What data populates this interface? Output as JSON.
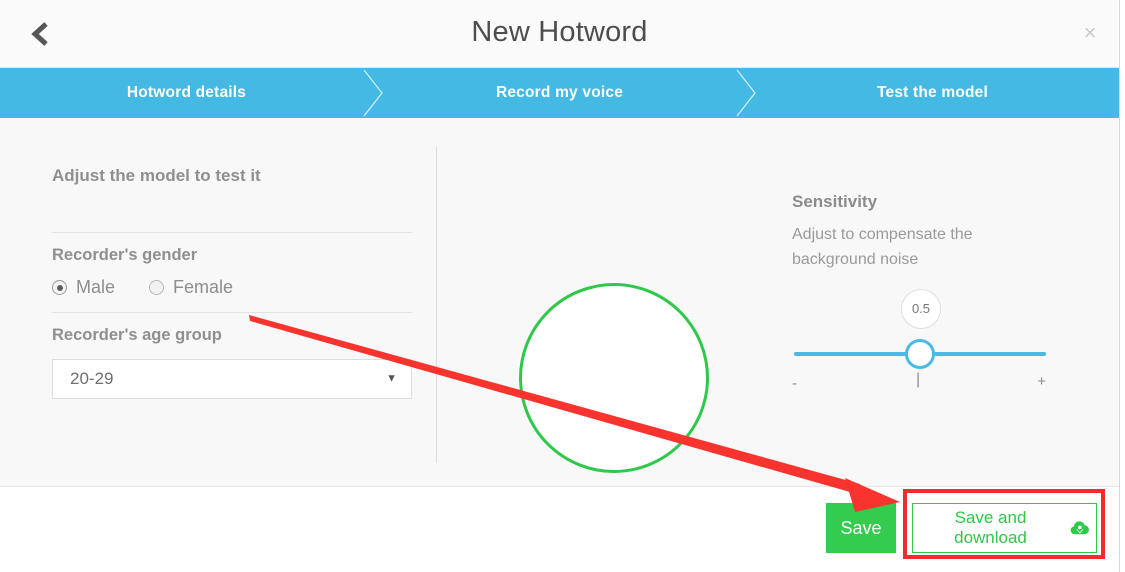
{
  "header": {
    "title": "New Hotword",
    "back_icon": "chevron-left-icon",
    "close_label": "×"
  },
  "steps": [
    {
      "label": "Hotword details"
    },
    {
      "label": "Record my voice"
    },
    {
      "label": "Test the model"
    }
  ],
  "main": {
    "left": {
      "section_title": "Adjust the model to test it",
      "gender_label": "Recorder's gender",
      "gender_options": [
        {
          "label": "Male",
          "selected": true
        },
        {
          "label": "Female",
          "selected": false
        }
      ],
      "age_label": "Recorder's age group",
      "age_value": "20-29"
    },
    "center": {
      "record_button_name": "record-circle"
    },
    "right": {
      "title": "Sensitivity",
      "description": "Adjust to compensate the background noise",
      "slider_value": "0.5",
      "mark_min": "-",
      "mark_mid": "|",
      "mark_max": "+"
    }
  },
  "footer": {
    "save_label": "Save",
    "download_label": "Save and download",
    "download_icon": "cloud-download-icon"
  },
  "colors": {
    "accent_blue": "#44b9e3",
    "slider_blue": "#4bb9e6",
    "green": "#2ec84a",
    "save_green": "#33cc4f",
    "annotation_red": "#f22b2b",
    "content_bg": "#f8f8f8",
    "header_bg": "#fafafa"
  }
}
